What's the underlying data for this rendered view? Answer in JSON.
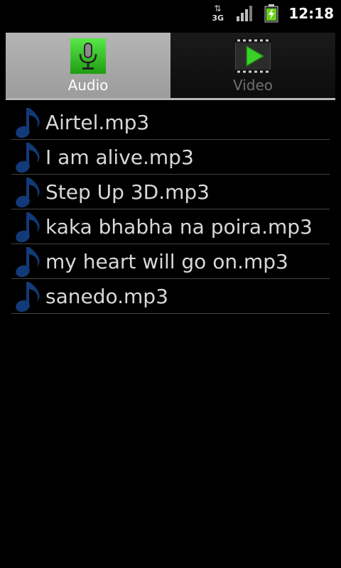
{
  "status_bar": {
    "network_type": "3G",
    "time": "12:18",
    "signal_icon": "signal-bars-icon",
    "battery_icon": "battery-charging-icon"
  },
  "tabs": [
    {
      "label": "Audio",
      "icon": "microphone-icon",
      "selected": true
    },
    {
      "label": "Video",
      "icon": "play-film-icon",
      "selected": false
    }
  ],
  "audio_files": [
    "Airtel.mp3",
    "I am alive.mp3",
    "Step Up 3D.mp3",
    "kaka bhabha na poira.mp3",
    "my heart will go on.mp3",
    "sanedo.mp3"
  ],
  "colors": {
    "accent_green": "#3ccf2a",
    "note_blue": "#123a78"
  }
}
